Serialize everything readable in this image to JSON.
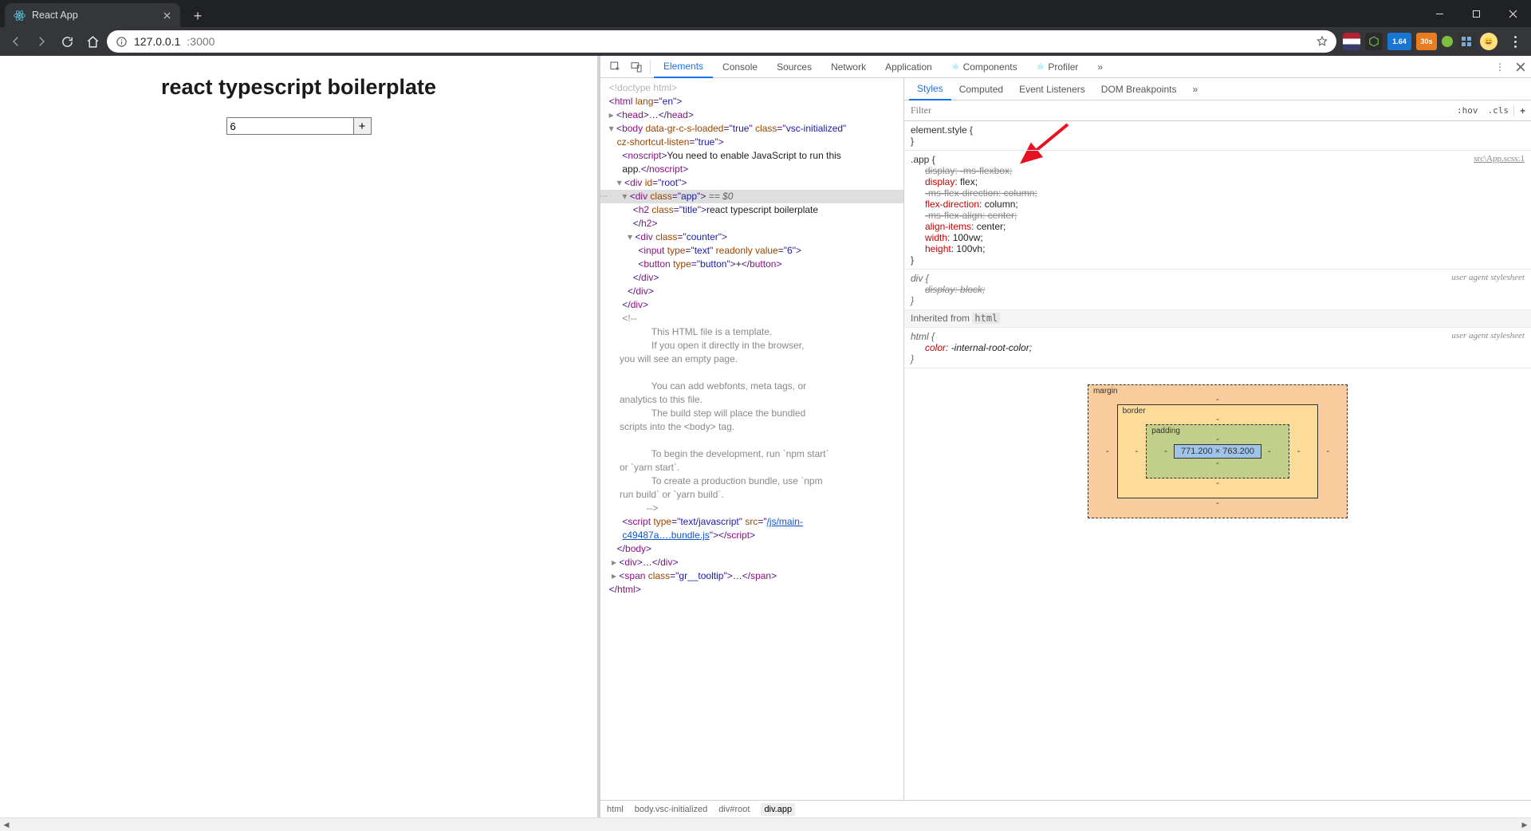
{
  "browser": {
    "tab_title": "React App",
    "url_host": "127.0.0.1",
    "url_port": ":3000",
    "security_label": "ⓘ"
  },
  "page": {
    "app_title": "react typescript boilerplate",
    "counter_value": "6",
    "counter_button": "+"
  },
  "devtools": {
    "tabs": {
      "elements": "Elements",
      "console": "Console",
      "sources": "Sources",
      "network": "Network",
      "application": "Application",
      "components": "Components",
      "profiler": "Profiler"
    },
    "elements_tree": {
      "doctype": "<!doctype html>",
      "html_open": "<html lang=\"en\">",
      "head": "<head>…</head>",
      "body_open": "<body data-gr-c-s-loaded=\"true\" class=\"vsc-initialized\" cz-shortcut-listen=\"true\">",
      "noscript": "You need to enable JavaScript to run this app.",
      "root_div": "<div id=\"root\">",
      "app_div": "<div class=\"app\">",
      "app_sel_token": " == $0",
      "h2": "react typescript boilerplate",
      "counter_div": "<div class=\"counter\">",
      "input": "<input type=\"text\" readonly value=\"6\">",
      "button": "<button type=\"button\">+</button>",
      "comment": "              This HTML file is a template.\n              If you open it directly in the browser, you will see an empty page.\n\n              You can add webfonts, meta tags, or analytics to this file.\n              The build step will place the bundled scripts into the <body> tag.\n\n              To begin the development, run `npm start` or `yarn start`.\n              To create a production bundle, use `npm run build` or `yarn build`.\n            ",
      "script_src": "/js/main-c49487a….bundle.js",
      "gr_tooltip": "<span class=\"gr__tooltip\">…</span>"
    },
    "crumbs": {
      "html": "html",
      "body": "body.vsc-initialized",
      "root": "div#root",
      "app": "div.app"
    },
    "styles_tabs": {
      "styles": "Styles",
      "computed": "Computed",
      "listeners": "Event Listeners",
      "dom_bp": "DOM Breakpoints"
    },
    "styles_toolbar": {
      "filter_placeholder": "Filter",
      "hov": ":hov",
      "cls": ".cls"
    },
    "rules": {
      "elstyle_sel": "element.style {",
      "app_sel": ".app {",
      "app_src": "src\\App.scss:1",
      "app_props": {
        "p1": "display: -ms-flexbox;",
        "p2n": "display",
        "p2v": "flex;",
        "p3": "-ms-flex-direction: column;",
        "p4n": "flex-direction",
        "p4v": "column;",
        "p5": "-ms-flex-align: center;",
        "p6n": "align-items",
        "p6v": "center;",
        "p7n": "width",
        "p7v": "100vw;",
        "p8n": "height",
        "p8v": "100vh;"
      },
      "div_sel": "div {",
      "div_src": "user agent stylesheet",
      "div_p1": "display: block;",
      "inherit_label": "Inherited from ",
      "inherit_tag": "html",
      "html_sel": "html {",
      "html_src": "user agent stylesheet",
      "html_p1n": "color",
      "html_p1v": "-internal-root-color;"
    },
    "box_model": {
      "margin": "margin",
      "border": "border",
      "padding": "padding",
      "content": "771.200 × 763.200",
      "dash": "-"
    }
  },
  "ext_badges": {
    "b1": "1.64",
    "b2": "30s"
  }
}
